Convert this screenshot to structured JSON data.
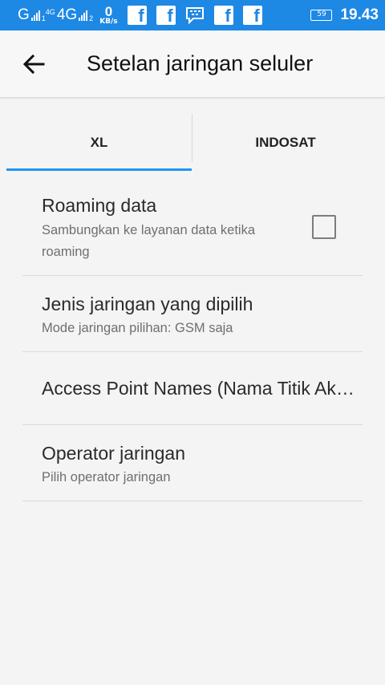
{
  "status_bar": {
    "carrier1": "G",
    "network_4g_small": "4G",
    "sim1_index": "1",
    "carrier2": "4G",
    "sim2_index": "2",
    "speed_value": "0",
    "speed_unit": "KB/s",
    "fb_letter": "f",
    "battery_level": "59",
    "time": "19.43",
    "colors": {
      "bar": "#1e88e5",
      "text": "#ffffff"
    },
    "icons": [
      "signal-icon",
      "facebook-icon",
      "facebook-icon",
      "bbm-icon",
      "facebook-icon",
      "facebook-icon",
      "battery-icon"
    ]
  },
  "toolbar": {
    "title": "Setelan jaringan seluler",
    "back_icon": "back-arrow-icon"
  },
  "tabs": [
    {
      "label": "XL",
      "selected": true
    },
    {
      "label": "INDOSAT",
      "selected": false
    }
  ],
  "accent_color": "#2196f3",
  "settings": [
    {
      "title": "Roaming data",
      "summary": "Sambungkan ke layanan data ketika roaming",
      "checked": false
    },
    {
      "title": "Jenis jaringan yang dipilih",
      "summary": "Mode jaringan pilihan: GSM saja"
    },
    {
      "title": "Access Point Names (Nama Titik Akses)",
      "summary": ""
    },
    {
      "title": "Operator jaringan",
      "summary": "Pilih operator jaringan"
    }
  ]
}
